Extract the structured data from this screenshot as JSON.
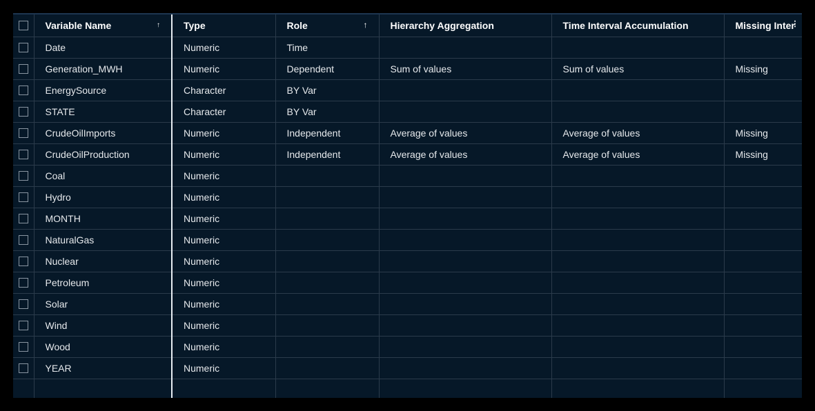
{
  "columns": {
    "name": "Variable Name",
    "type": "Type",
    "role": "Role",
    "hierarchy": "Hierarchy Aggregation",
    "time": "Time Interval Accumulation",
    "missing": "Missing Inter"
  },
  "icons": {
    "sort_asc": "↑",
    "column_menu": "⋮"
  },
  "rows": [
    {
      "name": "Date",
      "type": "Numeric",
      "role": "Time",
      "hierarchy": "",
      "time": "",
      "missing": ""
    },
    {
      "name": "Generation_MWH",
      "type": "Numeric",
      "role": "Dependent",
      "hierarchy": "Sum of values",
      "time": "Sum of values",
      "missing": "Missing"
    },
    {
      "name": "EnergySource",
      "type": "Character",
      "role": "BY Var",
      "hierarchy": "",
      "time": "",
      "missing": ""
    },
    {
      "name": "STATE",
      "type": "Character",
      "role": "BY Var",
      "hierarchy": "",
      "time": "",
      "missing": ""
    },
    {
      "name": "CrudeOilImports",
      "type": "Numeric",
      "role": "Independent",
      "hierarchy": "Average of values",
      "time": "Average of values",
      "missing": "Missing"
    },
    {
      "name": "CrudeOilProduction",
      "type": "Numeric",
      "role": "Independent",
      "hierarchy": "Average of values",
      "time": "Average of values",
      "missing": "Missing"
    },
    {
      "name": "Coal",
      "type": "Numeric",
      "role": "",
      "hierarchy": "",
      "time": "",
      "missing": ""
    },
    {
      "name": "Hydro",
      "type": "Numeric",
      "role": "",
      "hierarchy": "",
      "time": "",
      "missing": ""
    },
    {
      "name": "MONTH",
      "type": "Numeric",
      "role": "",
      "hierarchy": "",
      "time": "",
      "missing": ""
    },
    {
      "name": "NaturalGas",
      "type": "Numeric",
      "role": "",
      "hierarchy": "",
      "time": "",
      "missing": ""
    },
    {
      "name": "Nuclear",
      "type": "Numeric",
      "role": "",
      "hierarchy": "",
      "time": "",
      "missing": ""
    },
    {
      "name": "Petroleum",
      "type": "Numeric",
      "role": "",
      "hierarchy": "",
      "time": "",
      "missing": ""
    },
    {
      "name": "Solar",
      "type": "Numeric",
      "role": "",
      "hierarchy": "",
      "time": "",
      "missing": ""
    },
    {
      "name": "Wind",
      "type": "Numeric",
      "role": "",
      "hierarchy": "",
      "time": "",
      "missing": ""
    },
    {
      "name": "Wood",
      "type": "Numeric",
      "role": "",
      "hierarchy": "",
      "time": "",
      "missing": ""
    },
    {
      "name": "YEAR",
      "type": "Numeric",
      "role": "",
      "hierarchy": "",
      "time": "",
      "missing": ""
    }
  ]
}
